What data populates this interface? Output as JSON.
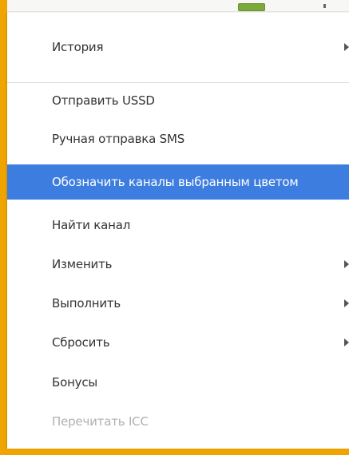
{
  "menu": {
    "items": [
      {
        "label": "История",
        "submenu": true
      },
      {
        "label": "Отправить USSD",
        "submenu": false
      },
      {
        "label": "Ручная отправка SMS",
        "submenu": false
      },
      {
        "label": "Обозначить каналы выбранным цветом",
        "submenu": false,
        "highlighted": true
      },
      {
        "label": "Найти канал",
        "submenu": false
      },
      {
        "label": "Изменить",
        "submenu": true
      },
      {
        "label": "Выполнить",
        "submenu": true
      },
      {
        "label": "Сбросить",
        "submenu": true
      },
      {
        "label": "Бонусы",
        "submenu": false
      },
      {
        "label": "Перечитать ICC",
        "submenu": false,
        "disabled": true
      }
    ]
  },
  "colors": {
    "highlight": "#3d7de0",
    "frame_border": "#f0a400",
    "text": "#333333",
    "disabled_text": "#b0b0b0"
  }
}
